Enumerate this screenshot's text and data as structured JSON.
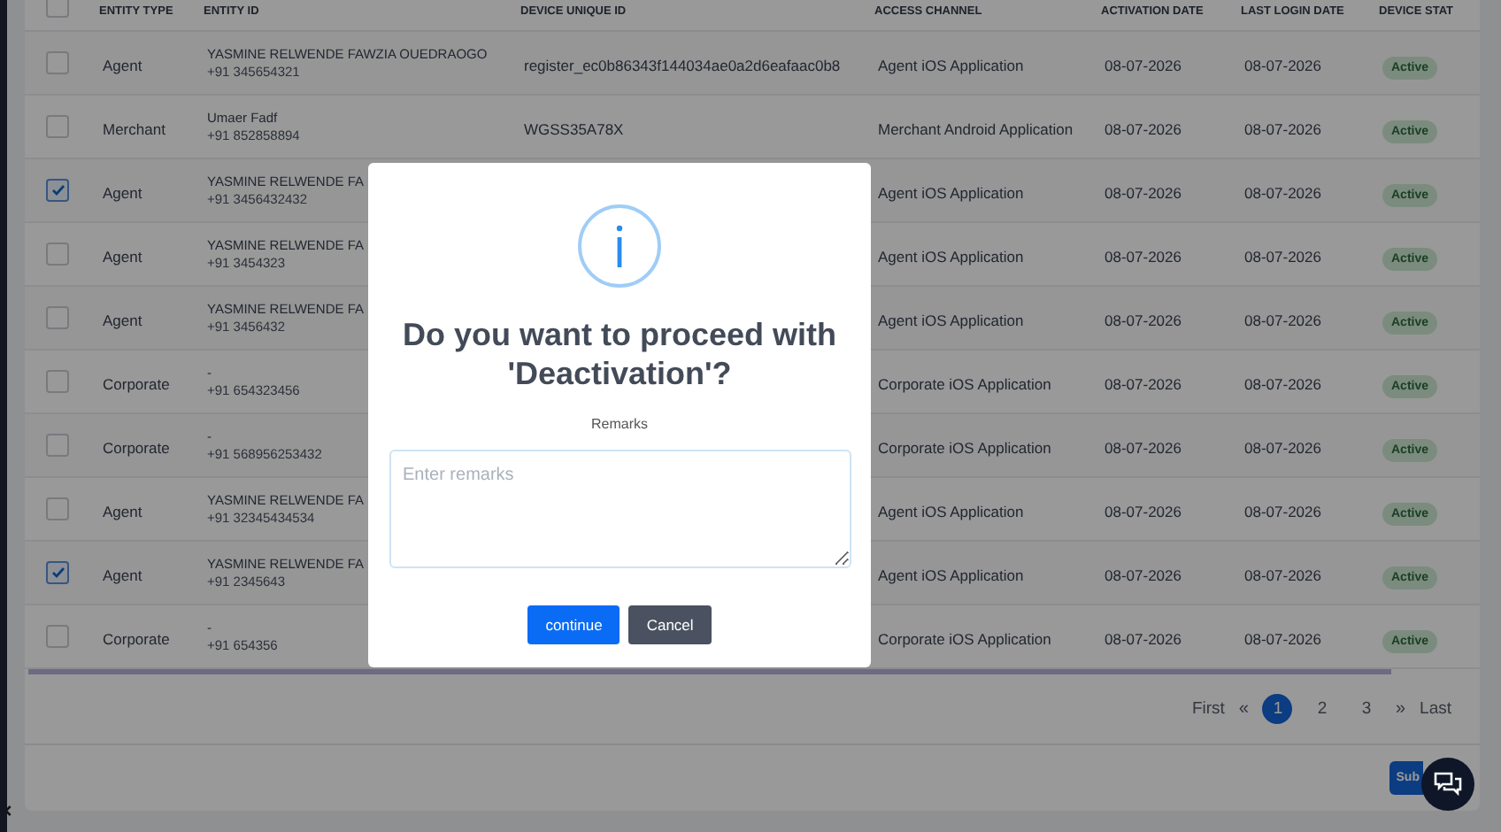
{
  "table": {
    "select_all_checked": false,
    "columns": [
      "ENTITY TYPE",
      "ENTITY ID",
      "DEVICE UNIQUE ID",
      "ACCESS CHANNEL",
      "ACTIVATION DATE",
      "LAST LOGIN DATE",
      "DEVICE STAT"
    ],
    "rows": [
      {
        "checked": false,
        "entity_type": "Agent",
        "entity_name": "YASMINE RELWENDE FAWZIA OUEDRAOGO",
        "entity_phone": "+91 345654321",
        "device_id": "register_ec0b86343f144034ae0a2d6eafaac0b8",
        "access_channel": "Agent iOS Application",
        "activation_date": "08-07-2026",
        "last_login_date": "08-07-2026",
        "status": "Active"
      },
      {
        "checked": false,
        "entity_type": "Merchant",
        "entity_name": "Umaer Fadf",
        "entity_phone": "+91 852858894",
        "device_id": "WGSS35A78X",
        "access_channel": "Merchant Android Application",
        "activation_date": "08-07-2026",
        "last_login_date": "08-07-2026",
        "status": "Active"
      },
      {
        "checked": true,
        "entity_type": "Agent",
        "entity_name": "YASMINE RELWENDE FA",
        "entity_phone": "+91 3456432432",
        "access_channel": "Agent iOS Application",
        "activation_date": "08-07-2026",
        "last_login_date": "08-07-2026",
        "status": "Active"
      },
      {
        "checked": false,
        "entity_type": "Agent",
        "entity_name": "YASMINE RELWENDE FA",
        "entity_phone": "+91 3454323",
        "access_channel": "Agent iOS Application",
        "activation_date": "08-07-2026",
        "last_login_date": "08-07-2026",
        "status": "Active"
      },
      {
        "checked": false,
        "entity_type": "Agent",
        "entity_name": "YASMINE RELWENDE FA",
        "entity_phone": "+91 3456432",
        "access_channel": "Agent iOS Application",
        "activation_date": "08-07-2026",
        "last_login_date": "08-07-2026",
        "status": "Active"
      },
      {
        "checked": false,
        "entity_type": "Corporate",
        "entity_name": "-",
        "entity_phone": "+91 654323456",
        "access_channel": "Corporate iOS Application",
        "activation_date": "08-07-2026",
        "last_login_date": "08-07-2026",
        "status": "Active"
      },
      {
        "checked": false,
        "entity_type": "Corporate",
        "entity_name": "-",
        "entity_phone": "+91 568956253432",
        "access_channel": "Corporate iOS Application",
        "activation_date": "08-07-2026",
        "last_login_date": "08-07-2026",
        "status": "Active"
      },
      {
        "checked": false,
        "entity_type": "Agent",
        "entity_name": "YASMINE RELWENDE FA",
        "entity_phone": "+91 32345434534",
        "access_channel": "Agent iOS Application",
        "activation_date": "08-07-2026",
        "last_login_date": "08-07-2026",
        "status": "Active"
      },
      {
        "checked": true,
        "entity_type": "Agent",
        "entity_name": "YASMINE RELWENDE FA",
        "entity_phone": "+91 2345643",
        "access_channel": "Agent iOS Application",
        "activation_date": "08-07-2026",
        "last_login_date": "08-07-2026",
        "status": "Active"
      },
      {
        "checked": false,
        "entity_type": "Corporate",
        "entity_name": "-",
        "entity_phone": "+91 654356",
        "access_channel": "Corporate iOS Application",
        "activation_date": "08-07-2026",
        "last_login_date": "08-07-2026",
        "status": "Active"
      }
    ]
  },
  "pagination": {
    "first": "First",
    "prev": "«",
    "pages": [
      {
        "label": "1",
        "selected": true
      },
      {
        "label": "2",
        "selected": false
      },
      {
        "label": "3",
        "selected": false
      }
    ],
    "next": "»",
    "last": "Last"
  },
  "submit_button": "Sub",
  "dialog": {
    "title": "Do you want to proceed with 'Deactivation'?",
    "remarks_label": "Remarks",
    "remarks_placeholder": "Enter remarks",
    "buttons": [
      {
        "label": "continue",
        "kind": "primary"
      },
      {
        "label": "Cancel",
        "kind": "secondary"
      }
    ]
  }
}
